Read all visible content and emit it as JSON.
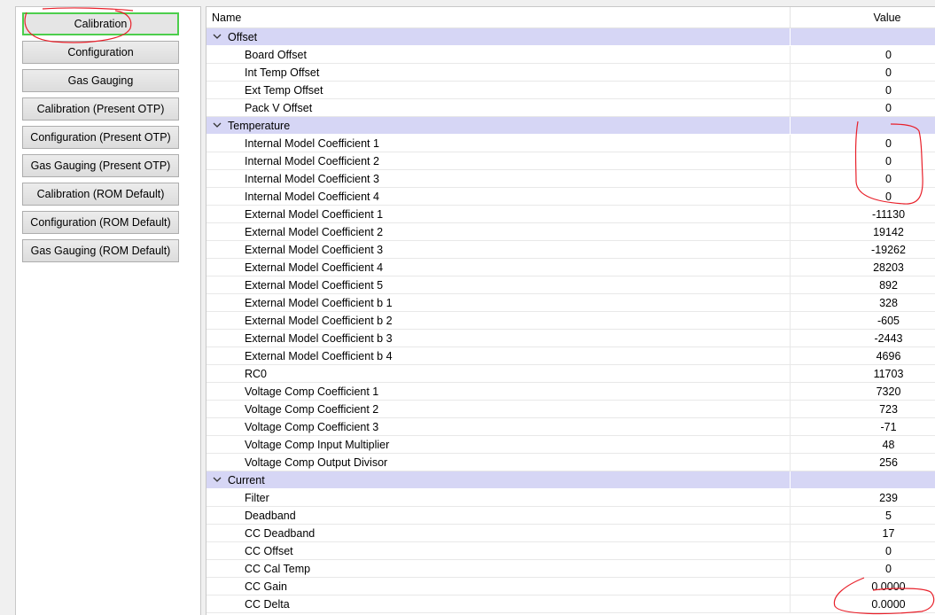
{
  "nav_buttons": [
    {
      "label": "Calibration",
      "active": true
    },
    {
      "label": "Configuration"
    },
    {
      "label": "Gas Gauging"
    },
    {
      "label": "Calibration (Present OTP)"
    },
    {
      "label": "Configuration (Present OTP)"
    },
    {
      "label": "Gas Gauging (Present OTP)"
    },
    {
      "label": "Calibration (ROM Default)"
    },
    {
      "label": "Configuration (ROM Default)"
    },
    {
      "label": "Gas Gauging (ROM Default)"
    }
  ],
  "grid": {
    "header_name": "Name",
    "header_value": "Value",
    "categories": [
      {
        "label": "Offset",
        "rows": [
          {
            "name": "Board Offset",
            "value": "0"
          },
          {
            "name": "Int Temp Offset",
            "value": "0"
          },
          {
            "name": "Ext Temp Offset",
            "value": "0"
          },
          {
            "name": "Pack V Offset",
            "value": "0"
          }
        ]
      },
      {
        "label": "Temperature",
        "rows": [
          {
            "name": "Internal Model Coefficient 1",
            "value": "0"
          },
          {
            "name": "Internal Model Coefficient 2",
            "value": "0"
          },
          {
            "name": "Internal Model Coefficient 3",
            "value": "0"
          },
          {
            "name": "Internal Model Coefficient 4",
            "value": "0"
          },
          {
            "name": "External Model Coefficient 1",
            "value": "-11130"
          },
          {
            "name": "External Model Coefficient 2",
            "value": "19142"
          },
          {
            "name": "External Model Coefficient 3",
            "value": "-19262"
          },
          {
            "name": "External Model Coefficient 4",
            "value": "28203"
          },
          {
            "name": "External Model Coefficient 5",
            "value": "892"
          },
          {
            "name": "External Model Coefficient b 1",
            "value": "328"
          },
          {
            "name": "External Model Coefficient b 2",
            "value": "-605"
          },
          {
            "name": "External Model Coefficient b 3",
            "value": "-2443"
          },
          {
            "name": "External Model Coefficient b 4",
            "value": "4696"
          },
          {
            "name": "RC0",
            "value": "11703"
          },
          {
            "name": "Voltage Comp Coefficient 1",
            "value": "7320"
          },
          {
            "name": "Voltage Comp Coefficient 2",
            "value": "723"
          },
          {
            "name": "Voltage Comp Coefficient 3",
            "value": "-71"
          },
          {
            "name": "Voltage Comp Input Multiplier",
            "value": "48"
          },
          {
            "name": "Voltage Comp Output Divisor",
            "value": "256"
          }
        ]
      },
      {
        "label": "Current",
        "rows": [
          {
            "name": "Filter",
            "value": "239"
          },
          {
            "name": "Deadband",
            "value": "5"
          },
          {
            "name": "CC Deadband",
            "value": "17"
          },
          {
            "name": "CC Offset",
            "value": "0"
          },
          {
            "name": "CC Cal Temp",
            "value": "0"
          },
          {
            "name": "CC Gain",
            "value": "0.0000"
          },
          {
            "name": "CC Delta",
            "value": "0.0000"
          }
        ]
      }
    ]
  },
  "colors": {
    "category_bg": "#d6d6f5",
    "active_border": "#4cce4c",
    "annotation": "#e8202a"
  },
  "icons": {
    "category_toggle": "chevron-down-icon"
  }
}
